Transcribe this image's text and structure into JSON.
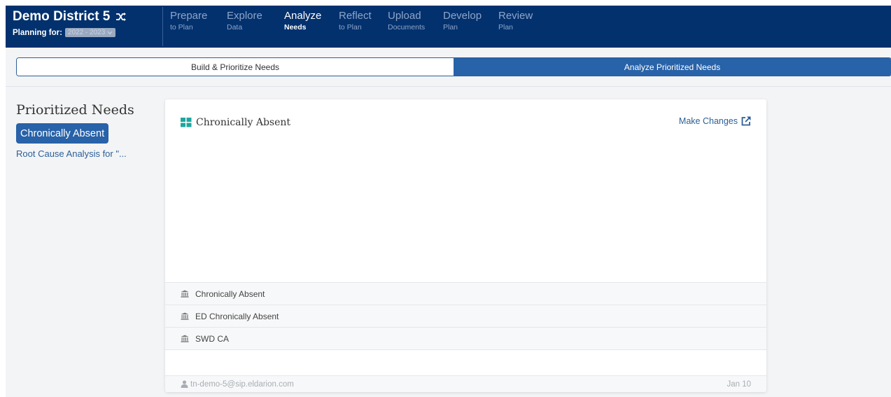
{
  "header": {
    "district_name": "Demo District 5",
    "planning_label": "Planning for:",
    "planning_year": "2022 - 2023",
    "nav": [
      {
        "main": "Prepare",
        "sub": "to Plan"
      },
      {
        "main": "Explore",
        "sub": "Data"
      },
      {
        "main": "Analyze",
        "sub": "Needs"
      },
      {
        "main": "Reflect",
        "sub": "to Plan"
      },
      {
        "main": "Upload",
        "sub": "Documents"
      },
      {
        "main": "Develop",
        "sub": "Plan"
      },
      {
        "main": "Review",
        "sub": "Plan"
      }
    ],
    "active_nav": "Analyze"
  },
  "tabs": {
    "build": "Build & Prioritize Needs",
    "analyze": "Analyze Prioritized Needs",
    "active": "Analyze Prioritized Needs"
  },
  "sidebar": {
    "heading": "Prioritized Needs",
    "active_item": "Chronically Absent",
    "link_item": "Root Cause Analysis for \"..."
  },
  "card": {
    "title": "Chronically Absent",
    "make_changes": "Make Changes",
    "rows": [
      "Chronically Absent",
      "ED Chronically Absent",
      "SWD CA"
    ],
    "author": "tn-demo-5@sip.eldarion.com",
    "date": "Jan 10"
  },
  "colors": {
    "navbar": "#03316e",
    "accent": "#2862a8",
    "link": "#2c5f96",
    "grid_icon": "#1ea7a0"
  },
  "icons": [
    "shuffle-icon",
    "chevron-down-icon",
    "grid-icon",
    "external-link-icon",
    "bank-icon",
    "user-icon"
  ]
}
